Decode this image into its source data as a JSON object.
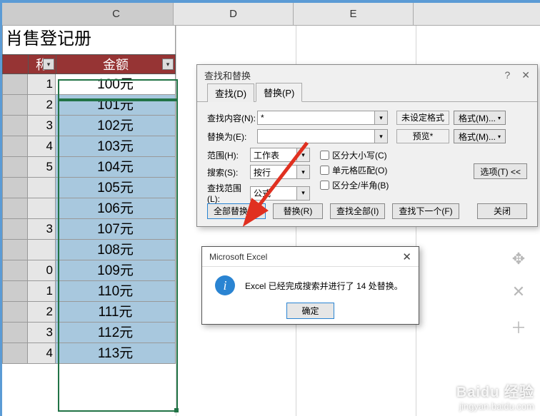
{
  "columns": {
    "C": "C",
    "D": "D",
    "E": "E"
  },
  "sheet_title": "肖售登记册",
  "headers": {
    "name": "称",
    "amount": "金额"
  },
  "rows": [
    {
      "n": "",
      "lbl": "1",
      "amt": "100元"
    },
    {
      "n": "",
      "lbl": "2",
      "amt": "101元"
    },
    {
      "n": "",
      "lbl": "3",
      "amt": "102元"
    },
    {
      "n": "",
      "lbl": "4",
      "amt": "103元"
    },
    {
      "n": "",
      "lbl": "5",
      "amt": "104元"
    },
    {
      "n": "",
      "lbl": "",
      "amt": "105元"
    },
    {
      "n": "",
      "lbl": "",
      "amt": "106元"
    },
    {
      "n": "",
      "lbl": "3",
      "amt": "107元"
    },
    {
      "n": "",
      "lbl": "",
      "amt": "108元"
    },
    {
      "n": "",
      "lbl": "0",
      "amt": "109元"
    },
    {
      "n": "",
      "lbl": "1",
      "amt": "110元"
    },
    {
      "n": "",
      "lbl": "2",
      "amt": "111元"
    },
    {
      "n": "",
      "lbl": "3",
      "amt": "112元"
    },
    {
      "n": "",
      "lbl": "4",
      "amt": "113元"
    }
  ],
  "dialog": {
    "title": "查找和替换",
    "tabs": {
      "find": "查找(D)",
      "replace": "替换(P)"
    },
    "labels": {
      "find_what": "查找内容(N):",
      "replace_with": "替换为(E):",
      "scope": "范围(H):",
      "search": "搜索(S):",
      "lookin": "查找范围(L):"
    },
    "values": {
      "find_what": "*",
      "replace_with": "",
      "scope": "工作表",
      "search": "按行",
      "lookin": "公式"
    },
    "format": {
      "none": "未设定格式",
      "preview": "预览*",
      "btn": "格式(M)..."
    },
    "checks": {
      "case": "区分大小写(C)",
      "whole": "单元格匹配(O)",
      "width": "区分全/半角(B)"
    },
    "options_btn": "选项(T) <<",
    "buttons": {
      "replace_all": "全部替换(A)",
      "replace": "替换(R)",
      "find_all": "查找全部(I)",
      "find_next": "查找下一个(F)",
      "close": "关闭"
    }
  },
  "msgbox": {
    "title": "Microsoft Excel",
    "body": "Excel 已经完成搜索并进行了 14 处替换。",
    "ok": "确定"
  },
  "watermark": {
    "brand": "Baidu 经验",
    "url": "jingyan.baidu.com"
  }
}
